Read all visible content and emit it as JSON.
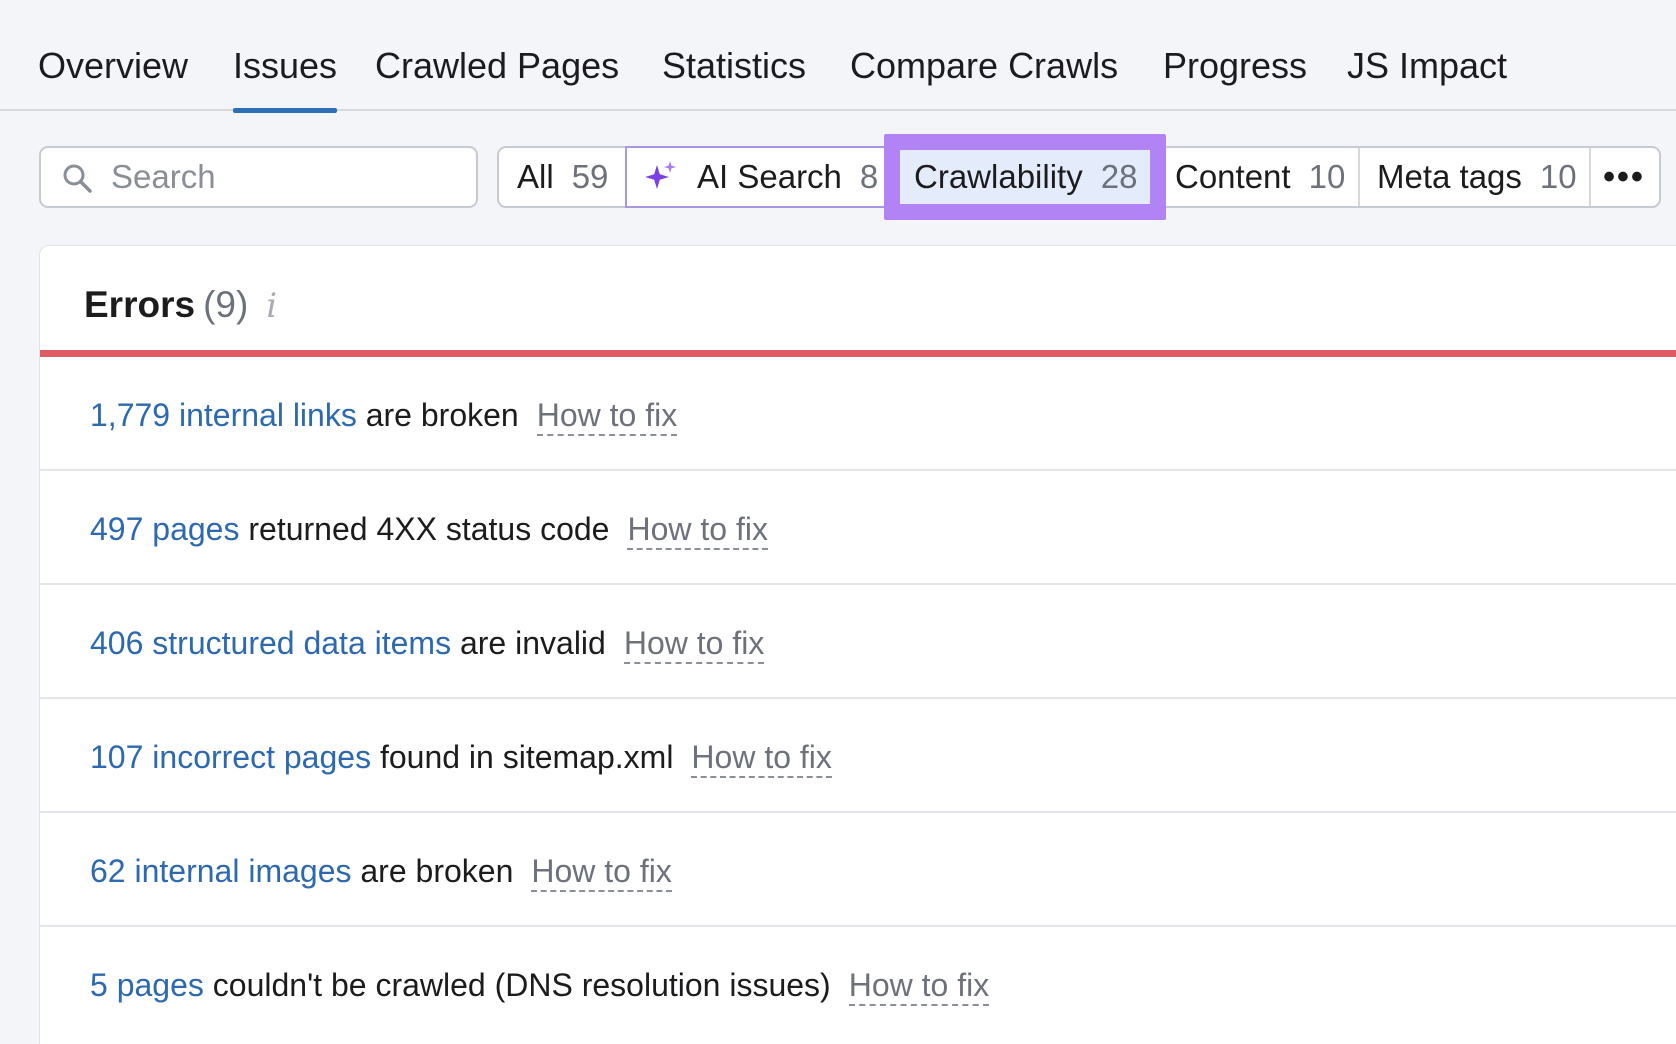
{
  "nav": {
    "tabs": [
      {
        "label": "Overview"
      },
      {
        "label": "Issues"
      },
      {
        "label": "Crawled Pages"
      },
      {
        "label": "Statistics"
      },
      {
        "label": "Compare Crawls"
      },
      {
        "label": "Progress"
      },
      {
        "label": "JS Impact"
      }
    ],
    "active_tab": "Issues"
  },
  "search": {
    "placeholder": "Search",
    "value": ""
  },
  "filters": {
    "all": {
      "label": "All",
      "count": "59"
    },
    "ai_search": {
      "label": "AI Search",
      "count": "8",
      "icon": "sparkle-icon"
    },
    "crawlability": {
      "label": "Crawlability",
      "count": "28",
      "selected": true
    },
    "content": {
      "label": "Content",
      "count": "10"
    },
    "meta_tags": {
      "label": "Meta tags",
      "count": "10"
    },
    "more": {
      "label": "•••"
    }
  },
  "errors": {
    "title": "Errors",
    "count": "(9)",
    "info_icon": "i",
    "rows": [
      {
        "link": "1,779 internal links",
        "text": " are broken",
        "fix": "How to fix"
      },
      {
        "link": "497 pages",
        "text": " returned 4XX status code",
        "fix": "How to fix"
      },
      {
        "link": "406 structured data items",
        "text": " are invalid",
        "fix": "How to fix"
      },
      {
        "link": "107 incorrect pages",
        "text": " found in sitemap.xml",
        "fix": "How to fix"
      },
      {
        "link": "62 internal images",
        "text": " are broken",
        "fix": "How to fix"
      },
      {
        "link": "5 pages",
        "text": " couldn't be crawled (DNS resolution issues)",
        "fix": "How to fix"
      }
    ]
  },
  "colors": {
    "accent": "#2f6fb6",
    "link": "#2d69b0",
    "error_bar": "#de5b63",
    "highlight": "#b183f5",
    "selected_bg": "#e4ecfb"
  }
}
